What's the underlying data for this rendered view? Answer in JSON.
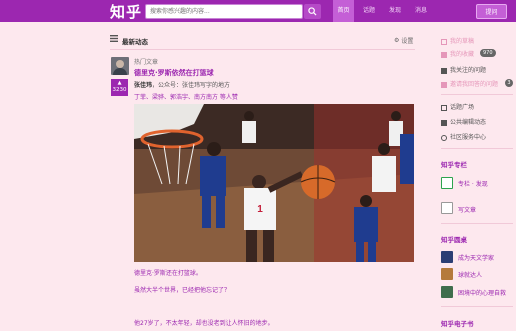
{
  "header": {
    "logo": "知乎",
    "search_placeholder": "搜索你感兴趣的内容...",
    "nav": [
      "首页",
      "话题",
      "发现",
      "消息"
    ],
    "ask_button": "提问"
  },
  "feed": {
    "title": "最新动态",
    "settings": "设置"
  },
  "post": {
    "topic": "热门文章",
    "title": "德里克·罗斯依然在打篮球",
    "vote_count": "3230",
    "author_name": "张佳玮",
    "author_desc": "，公众号：张佳玮写字的地方",
    "endorsed_by": "丁菲、梁骅、郭浩宇、南方南方 等人赞",
    "excerpt": [
      "德里克·罗斯还在打篮球。",
      "虽然大半个世界，已经把他忘记了？",
      "他27岁了，不太年轻，却也没老到让人怀旧的地步。"
    ]
  },
  "sidebar": {
    "links_top": [
      {
        "label": "我的草稿",
        "icon": "draft-icon"
      },
      {
        "label": "我的收藏",
        "icon": "bookmark-icon"
      },
      {
        "label": "我关注的问题",
        "icon": "star-icon"
      },
      {
        "label": "邀请我回答的问题",
        "icon": "invite-icon"
      }
    ],
    "bookmark_badge": "970",
    "invite_badge": "3",
    "links_bottom": [
      {
        "label": "话题广场",
        "icon": "grid-icon"
      },
      {
        "label": "公共编辑动态",
        "icon": "edit-icon"
      },
      {
        "label": "社区服务中心",
        "icon": "gear-icon"
      }
    ],
    "column_title": "知乎专栏",
    "column_items": [
      "专栏 · 发现",
      "写文章"
    ],
    "roundtable_title": "知乎圆桌",
    "roundtable_items": [
      "成为天文学家",
      "球就达人",
      "困境中的心理自救"
    ],
    "ebook_title": "知乎电子书"
  },
  "colors": {
    "brand": "#9c27b0",
    "background": "#fde8ee",
    "accent": "#c45fd6"
  }
}
